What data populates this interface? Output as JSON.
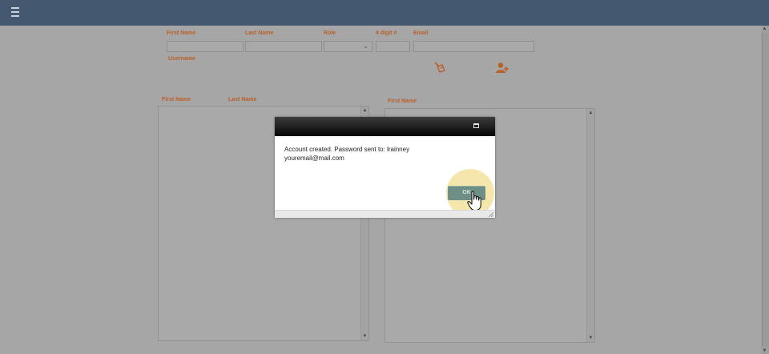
{
  "topbar": {
    "menu_icon": "hamburger-menu-icon"
  },
  "form": {
    "first_name_label": "First Name",
    "last_name_label": "Last Name",
    "role_label": "Role",
    "digit_label": "4 digit #",
    "email_label": "Email",
    "username_label": "Username",
    "first_name_value": "",
    "last_name_value": "",
    "role_value": "",
    "digit_value": "",
    "email_value": "",
    "clear_icon": "broom-icon",
    "add_user_icon": "add-user-icon"
  },
  "left_panel": {
    "first_name_header": "First Name",
    "last_name_header": "Last Name"
  },
  "right_panel": {
    "first_name_header": "First Name"
  },
  "dialog": {
    "message_line1": "Account created. Password sent to: lrainney",
    "message_line2": "youremail@mail.com",
    "ok_label": "OK",
    "maximize_icon": "maximize-icon"
  },
  "colors": {
    "topbar": "#44596f",
    "label": "#b9612b",
    "ok_button": "#6d8f86",
    "overlay_background": "#a6a6a6"
  }
}
